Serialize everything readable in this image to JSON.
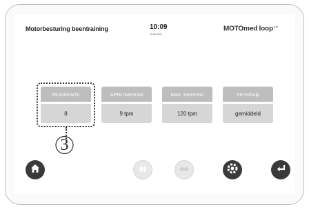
{
  "header": {
    "title": "Motorbesturing beentraining",
    "time": "10:09",
    "date": "16.06.2023",
    "brand": "MOTOmed loop",
    "brand_suffix": "p.la"
  },
  "tiles": [
    {
      "label": "Motorkracht",
      "value": "8"
    },
    {
      "label": "APW toerental",
      "value": "9 tpm"
    },
    {
      "label": "Max. toerental",
      "value": "120 tpm"
    },
    {
      "label": "Servohulp",
      "value": "gemiddeld"
    }
  ],
  "callout": {
    "number": "3"
  },
  "colors": {
    "tile_head": "#bdbdbd",
    "tile_value": "#d6d6d6",
    "dark_button": "#3a3a3a",
    "light_button": "#e8e8e8"
  },
  "footer": {
    "icons": [
      "home-icon",
      "feet-icon",
      "hands-icon",
      "settings-gear-icon",
      "back-arrow-icon"
    ]
  }
}
